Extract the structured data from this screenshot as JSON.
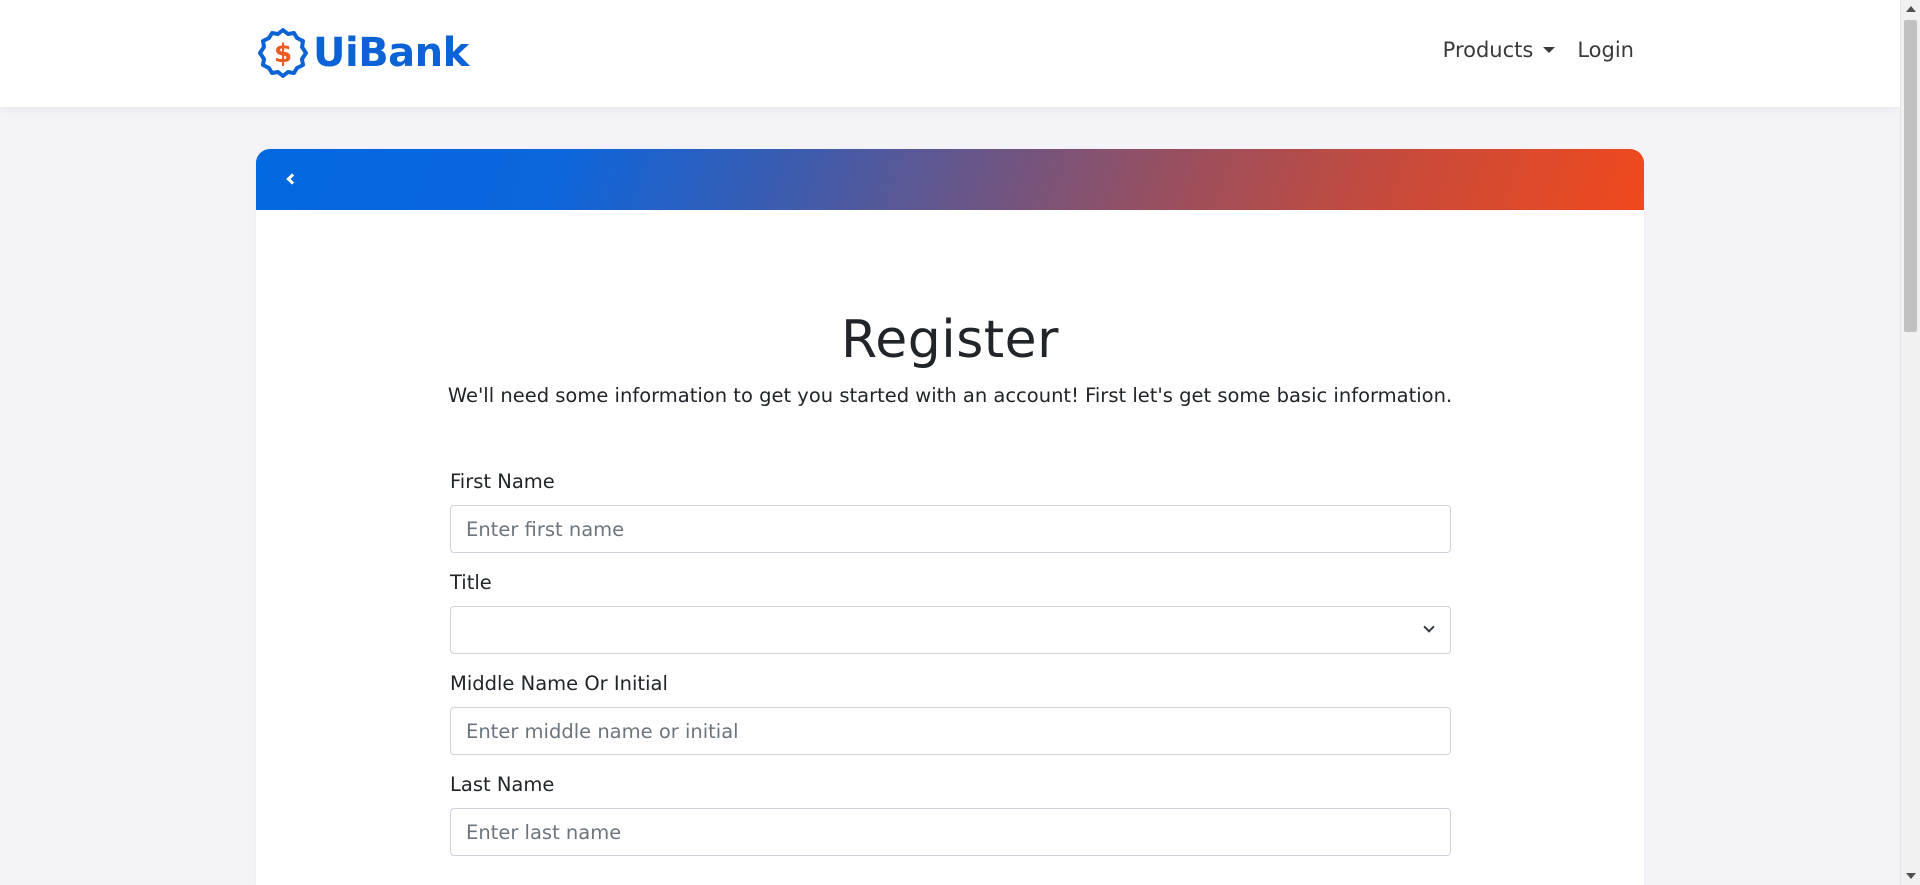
{
  "navbar": {
    "brand": "UiBank",
    "products_label": "Products",
    "login_label": "Login"
  },
  "page": {
    "title": "Register",
    "subtitle": "We'll need some information to get you started with an account! First let's get some basic information."
  },
  "form": {
    "first_name": {
      "label": "First Name",
      "placeholder": "Enter first name",
      "value": ""
    },
    "title": {
      "label": "Title",
      "value": ""
    },
    "middle_name": {
      "label": "Middle Name Or Initial",
      "placeholder": "Enter middle name or initial",
      "value": ""
    },
    "last_name": {
      "label": "Last Name",
      "placeholder": "Enter last name",
      "value": ""
    }
  },
  "colors": {
    "brand_blue": "#0b63d6",
    "logo_orange": "#f05a22",
    "gradient_start": "#0068e0",
    "gradient_end": "#f0491c"
  },
  "icons": {
    "logo": "dollar-badge-icon",
    "products_caret": "caret-down-icon",
    "back": "chevron-left-icon",
    "select": "chevron-down-icon"
  }
}
